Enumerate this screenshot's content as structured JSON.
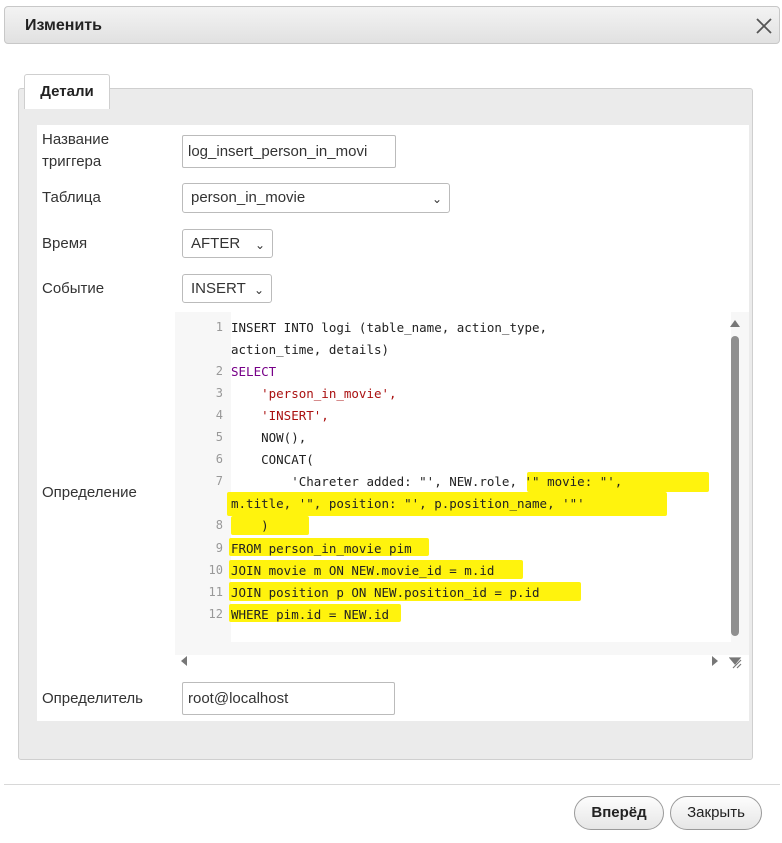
{
  "dialog": {
    "title": "Изменить"
  },
  "tab": {
    "label": "Детали"
  },
  "form": {
    "name_label_1": "Название",
    "name_label_2": "триггера",
    "name_value": "log_insert_person_in_movi",
    "table_label": "Таблица",
    "table_value": "person_in_movie",
    "time_label": "Время",
    "time_value": "AFTER",
    "event_label": "Событие",
    "event_value": "INSERT",
    "definition_label": "Определение",
    "definer_label": "Определитель",
    "definer_value": "root@localhost"
  },
  "editor": {
    "line_numbers": [
      "1",
      "2",
      "3",
      "4",
      "5",
      "6",
      "7",
      "8",
      "9",
      "10",
      "11",
      "12"
    ],
    "code_lines": [
      "INSERT INTO logi (table_name, action_type,",
      "action_time, details)",
      "SELECT",
      "    'person_in_movie',",
      "    'INSERT',",
      "    NOW(),",
      "    CONCAT(",
      "        'Chareter added: \"', NEW.role, '\" movie: \"',",
      "m.title, '\", position: \"', p.position_name, '\"'",
      "    )",
      "FROM person_in_movie pim",
      "JOIN movie m ON NEW.movie_id = m.id",
      "JOIN position p ON NEW.position_id = p.id",
      "WHERE pim.id = NEW.id"
    ]
  },
  "buttons": {
    "next": "Вперёд",
    "close": "Закрыть"
  },
  "icons": {
    "close": "close-icon",
    "chevron": "chevron-down-icon"
  },
  "colors": {
    "highlight": "#fff200",
    "keyword": "#770088",
    "string": "#aa1111"
  }
}
